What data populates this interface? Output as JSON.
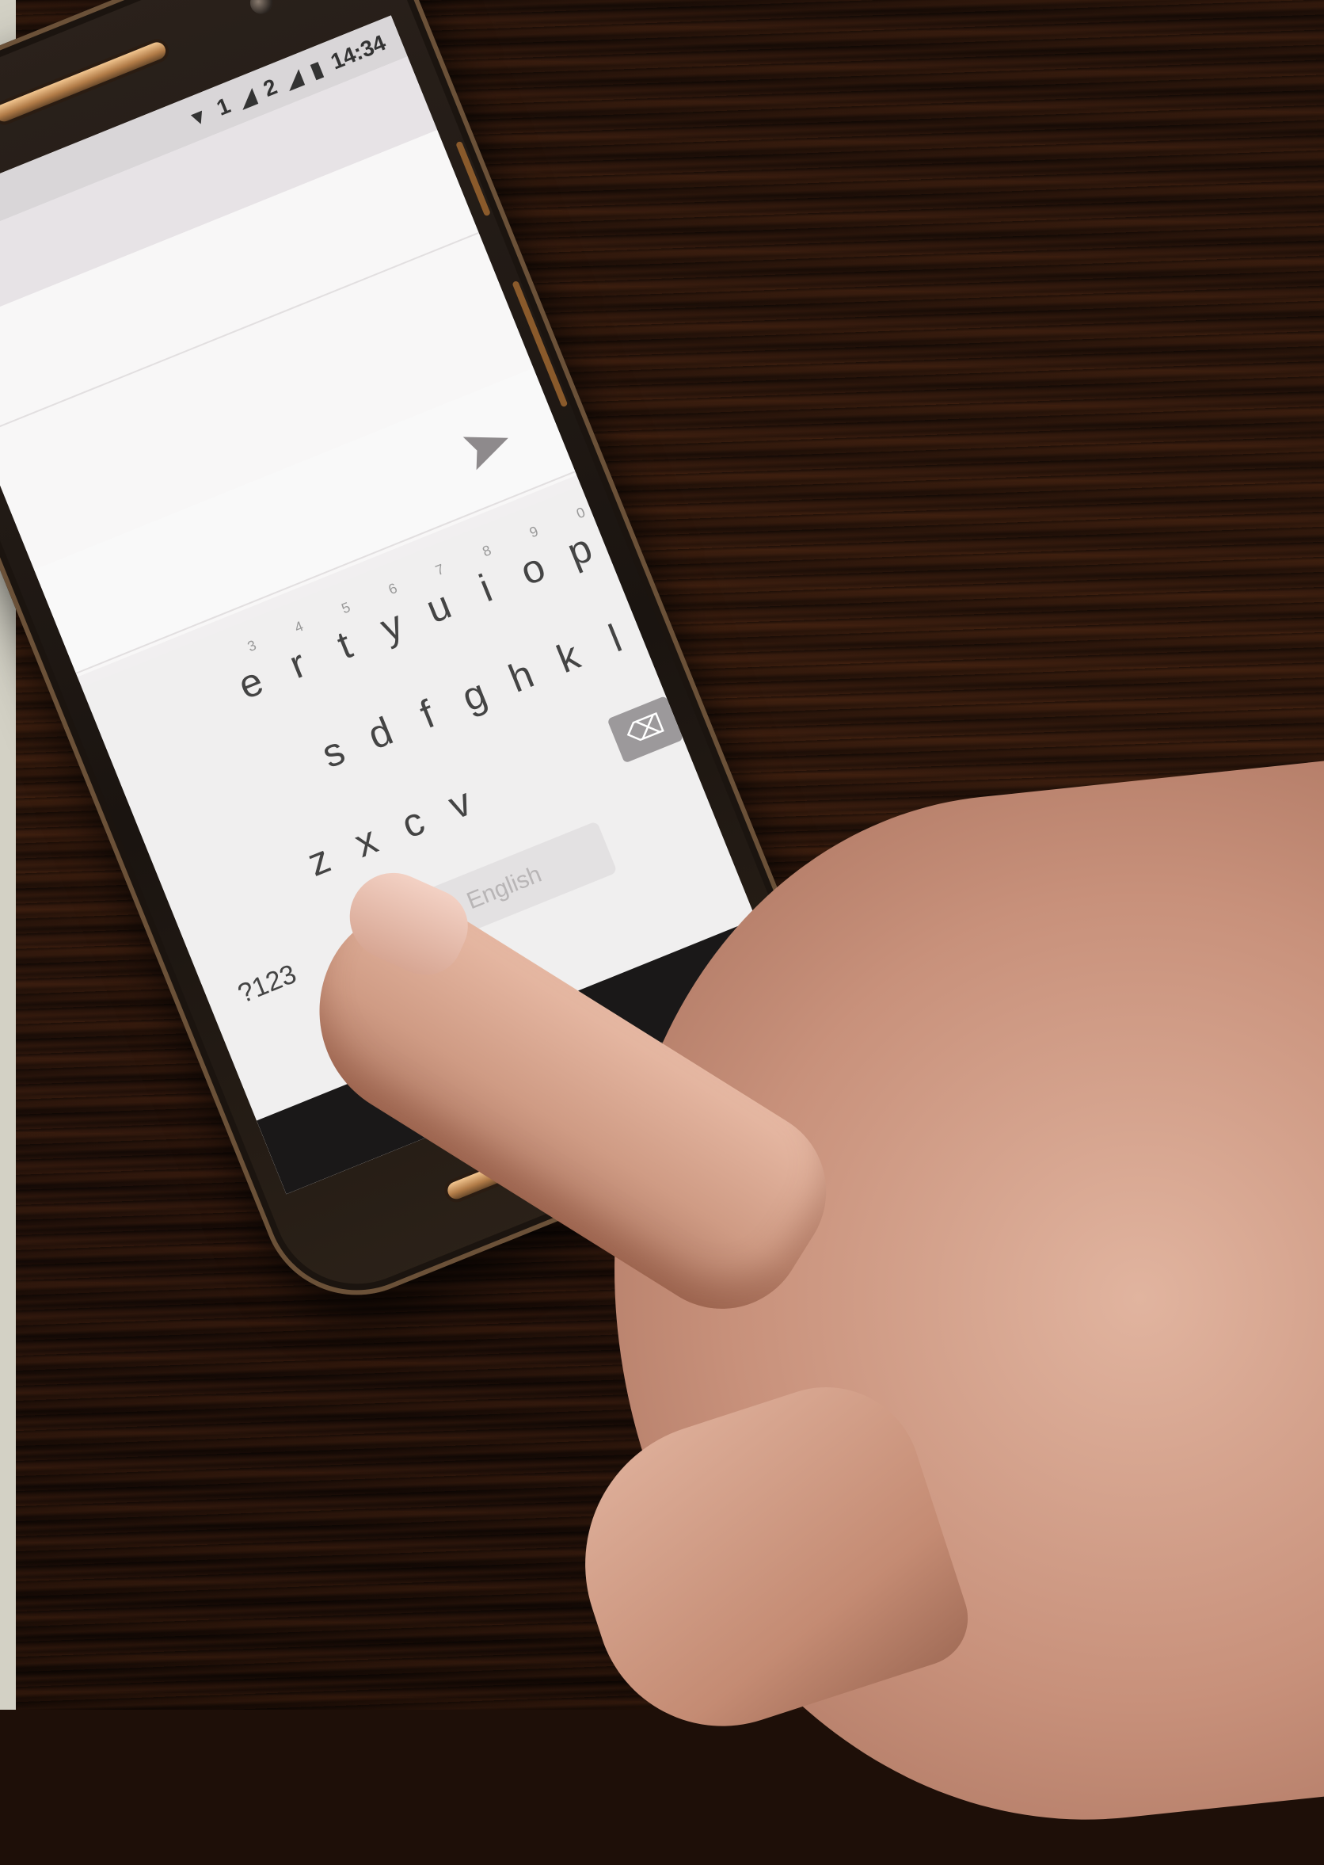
{
  "statusbar": {
    "sim1": "1",
    "sim2": "2",
    "time": "14:34",
    "icons": [
      "wifi-icon",
      "signal-icon",
      "battery-icon"
    ]
  },
  "compose": {
    "send_icon": "send-icon"
  },
  "keyboard": {
    "row1": [
      {
        "key": "e",
        "hint": "3"
      },
      {
        "key": "r",
        "hint": "4"
      },
      {
        "key": "t",
        "hint": "5"
      },
      {
        "key": "y",
        "hint": "6"
      },
      {
        "key": "u",
        "hint": "7"
      },
      {
        "key": "i",
        "hint": "8"
      },
      {
        "key": "o",
        "hint": "9"
      },
      {
        "key": "p",
        "hint": "0"
      }
    ],
    "row2": [
      "s",
      "d",
      "f",
      "g",
      "h",
      "k",
      "l"
    ],
    "row3": [
      "z",
      "x",
      "c",
      "v"
    ],
    "symbols_key": "?123",
    "comma_key": ",",
    "globe_icon": "globe-icon",
    "spacebar_label": "English",
    "delete_icon": "delete-icon"
  },
  "navbar": {
    "back": "▽",
    "home": "○"
  }
}
